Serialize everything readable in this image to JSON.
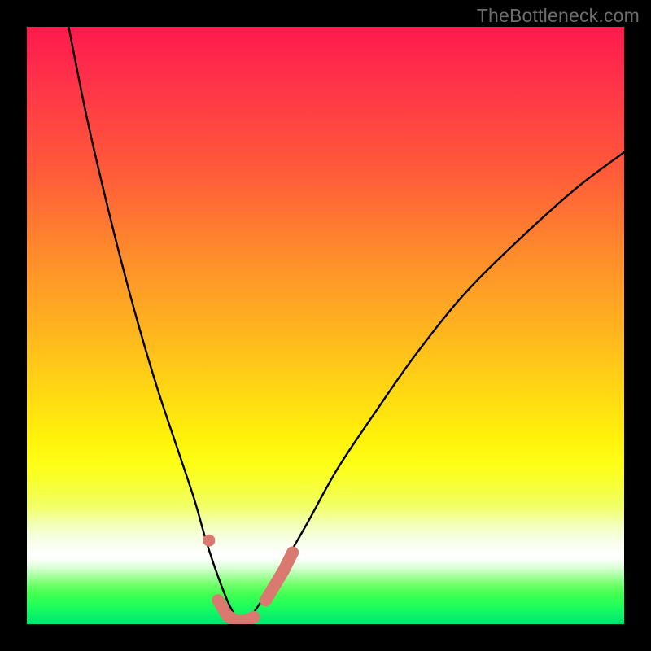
{
  "watermark": "TheBottleneck.com",
  "chart_data": {
    "type": "line",
    "title": "",
    "xlabel": "",
    "ylabel": "",
    "xlim": [
      0,
      100
    ],
    "ylim": [
      0,
      100
    ],
    "note": "Axes unlabeled; values are relative positions (0–100). Curve depicts bottleneck magnitude vs. a component-balance axis with optimum near x≈36 where the curve touches 0.",
    "series": [
      {
        "name": "bottleneck-curve",
        "x": [
          7,
          10,
          13,
          16,
          19,
          22,
          25,
          28,
          30,
          32,
          34,
          36,
          38,
          40,
          43,
          47,
          52,
          58,
          65,
          73,
          82,
          92,
          100
        ],
        "y": [
          100,
          85,
          72,
          60,
          49,
          39,
          30,
          21,
          14,
          8,
          3,
          0,
          2,
          5,
          10,
          17,
          26,
          35,
          45,
          55,
          64,
          73,
          79
        ]
      },
      {
        "name": "highlight-dot",
        "x": [
          30.5
        ],
        "y": [
          14
        ]
      },
      {
        "name": "highlight-band-left",
        "x": [
          32,
          33.5,
          35,
          36.5,
          38
        ],
        "y": [
          4,
          1.5,
          0.5,
          0.5,
          1.2
        ]
      },
      {
        "name": "highlight-band-right",
        "x": [
          40,
          41.5,
          43,
          44.5
        ],
        "y": [
          4,
          6.5,
          9,
          12
        ]
      }
    ],
    "colors": {
      "curve": "#000000",
      "highlight": "#d9796f",
      "gradient_top": "#ff1a4d",
      "gradient_mid": "#fff20a",
      "gradient_bottom": "#00e572"
    }
  }
}
